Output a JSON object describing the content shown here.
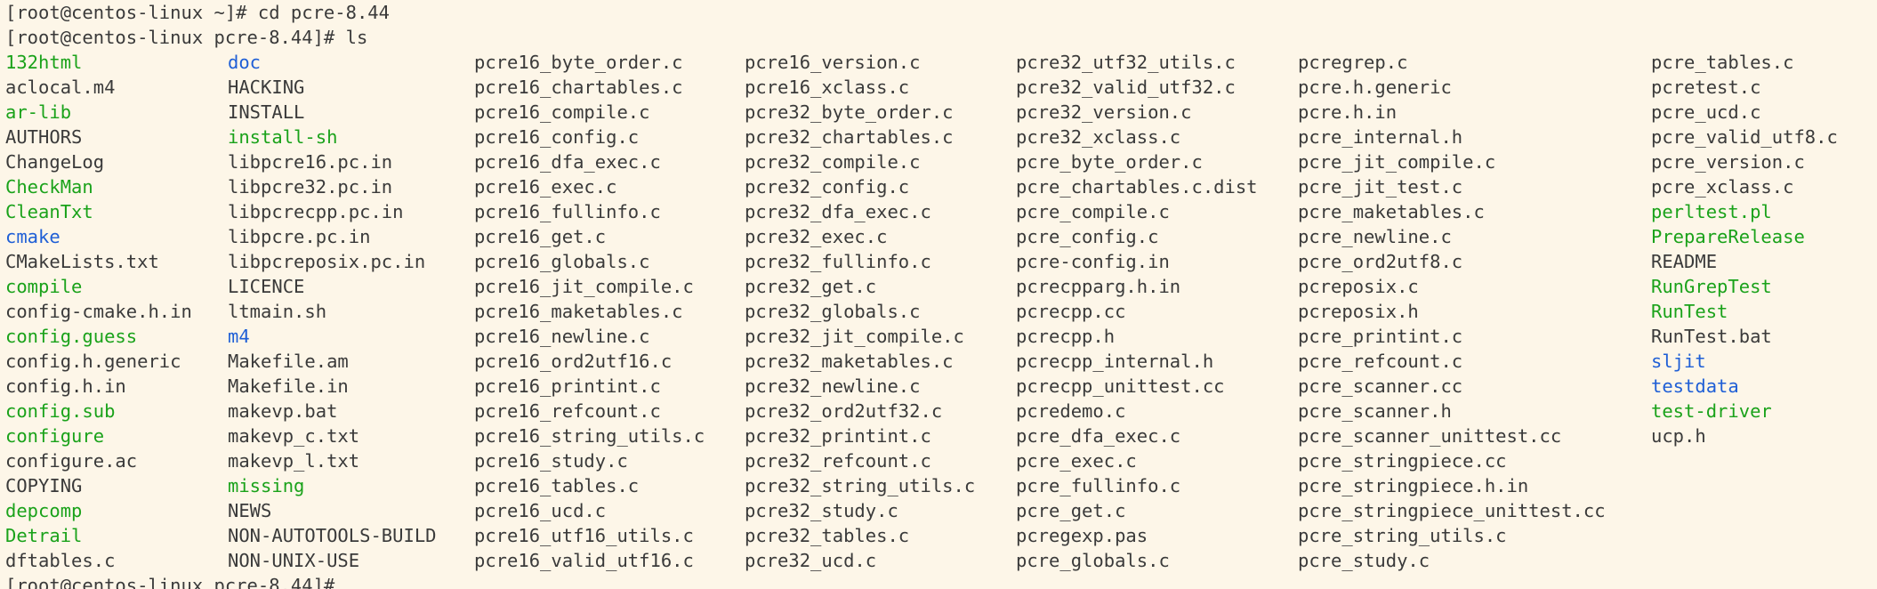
{
  "terminal": {
    "lines": [
      "[root@centos-linux ~]# cd pcre-8.44",
      "[root@centos-linux pcre-8.44]# ls"
    ],
    "final_prompt": "[root@centos-linux pcre-8.44]#",
    "colors": {
      "background": "#fdf6e8",
      "text": "#3a3a3a",
      "executable": "#1aa21a",
      "directory": "#1f5fd6"
    },
    "columns": [
      [
        {
          "name": "132html",
          "type": "exec"
        },
        {
          "name": "aclocal.m4",
          "type": "file"
        },
        {
          "name": "ar-lib",
          "type": "exec"
        },
        {
          "name": "AUTHORS",
          "type": "file"
        },
        {
          "name": "ChangeLog",
          "type": "file"
        },
        {
          "name": "CheckMan",
          "type": "exec"
        },
        {
          "name": "CleanTxt",
          "type": "exec"
        },
        {
          "name": "cmake",
          "type": "dir"
        },
        {
          "name": "CMakeLists.txt",
          "type": "file"
        },
        {
          "name": "compile",
          "type": "exec"
        },
        {
          "name": "config-cmake.h.in",
          "type": "file"
        },
        {
          "name": "config.guess",
          "type": "exec"
        },
        {
          "name": "config.h.generic",
          "type": "file"
        },
        {
          "name": "config.h.in",
          "type": "file"
        },
        {
          "name": "config.sub",
          "type": "exec"
        },
        {
          "name": "configure",
          "type": "exec"
        },
        {
          "name": "configure.ac",
          "type": "file"
        },
        {
          "name": "COPYING",
          "type": "file"
        },
        {
          "name": "depcomp",
          "type": "exec"
        },
        {
          "name": "Detrail",
          "type": "exec"
        },
        {
          "name": "dftables.c",
          "type": "file"
        }
      ],
      [
        {
          "name": "doc",
          "type": "dir"
        },
        {
          "name": "HACKING",
          "type": "file"
        },
        {
          "name": "INSTALL",
          "type": "file"
        },
        {
          "name": "install-sh",
          "type": "exec"
        },
        {
          "name": "libpcre16.pc.in",
          "type": "file"
        },
        {
          "name": "libpcre32.pc.in",
          "type": "file"
        },
        {
          "name": "libpcrecpp.pc.in",
          "type": "file"
        },
        {
          "name": "libpcre.pc.in",
          "type": "file"
        },
        {
          "name": "libpcreposix.pc.in",
          "type": "file"
        },
        {
          "name": "LICENCE",
          "type": "file"
        },
        {
          "name": "ltmain.sh",
          "type": "file"
        },
        {
          "name": "m4",
          "type": "dir"
        },
        {
          "name": "Makefile.am",
          "type": "file"
        },
        {
          "name": "Makefile.in",
          "type": "file"
        },
        {
          "name": "makevp.bat",
          "type": "file"
        },
        {
          "name": "makevp_c.txt",
          "type": "file"
        },
        {
          "name": "makevp_l.txt",
          "type": "file"
        },
        {
          "name": "missing",
          "type": "exec"
        },
        {
          "name": "NEWS",
          "type": "file"
        },
        {
          "name": "NON-AUTOTOOLS-BUILD",
          "type": "file"
        },
        {
          "name": "NON-UNIX-USE",
          "type": "file"
        }
      ],
      [
        {
          "name": "pcre16_byte_order.c",
          "type": "file"
        },
        {
          "name": "pcre16_chartables.c",
          "type": "file"
        },
        {
          "name": "pcre16_compile.c",
          "type": "file"
        },
        {
          "name": "pcre16_config.c",
          "type": "file"
        },
        {
          "name": "pcre16_dfa_exec.c",
          "type": "file"
        },
        {
          "name": "pcre16_exec.c",
          "type": "file"
        },
        {
          "name": "pcre16_fullinfo.c",
          "type": "file"
        },
        {
          "name": "pcre16_get.c",
          "type": "file"
        },
        {
          "name": "pcre16_globals.c",
          "type": "file"
        },
        {
          "name": "pcre16_jit_compile.c",
          "type": "file"
        },
        {
          "name": "pcre16_maketables.c",
          "type": "file"
        },
        {
          "name": "pcre16_newline.c",
          "type": "file"
        },
        {
          "name": "pcre16_ord2utf16.c",
          "type": "file"
        },
        {
          "name": "pcre16_printint.c",
          "type": "file"
        },
        {
          "name": "pcre16_refcount.c",
          "type": "file"
        },
        {
          "name": "pcre16_string_utils.c",
          "type": "file"
        },
        {
          "name": "pcre16_study.c",
          "type": "file"
        },
        {
          "name": "pcre16_tables.c",
          "type": "file"
        },
        {
          "name": "pcre16_ucd.c",
          "type": "file"
        },
        {
          "name": "pcre16_utf16_utils.c",
          "type": "file"
        },
        {
          "name": "pcre16_valid_utf16.c",
          "type": "file"
        }
      ],
      [
        {
          "name": "pcre16_version.c",
          "type": "file"
        },
        {
          "name": "pcre16_xclass.c",
          "type": "file"
        },
        {
          "name": "pcre32_byte_order.c",
          "type": "file"
        },
        {
          "name": "pcre32_chartables.c",
          "type": "file"
        },
        {
          "name": "pcre32_compile.c",
          "type": "file"
        },
        {
          "name": "pcre32_config.c",
          "type": "file"
        },
        {
          "name": "pcre32_dfa_exec.c",
          "type": "file"
        },
        {
          "name": "pcre32_exec.c",
          "type": "file"
        },
        {
          "name": "pcre32_fullinfo.c",
          "type": "file"
        },
        {
          "name": "pcre32_get.c",
          "type": "file"
        },
        {
          "name": "pcre32_globals.c",
          "type": "file"
        },
        {
          "name": "pcre32_jit_compile.c",
          "type": "file"
        },
        {
          "name": "pcre32_maketables.c",
          "type": "file"
        },
        {
          "name": "pcre32_newline.c",
          "type": "file"
        },
        {
          "name": "pcre32_ord2utf32.c",
          "type": "file"
        },
        {
          "name": "pcre32_printint.c",
          "type": "file"
        },
        {
          "name": "pcre32_refcount.c",
          "type": "file"
        },
        {
          "name": "pcre32_string_utils.c",
          "type": "file"
        },
        {
          "name": "pcre32_study.c",
          "type": "file"
        },
        {
          "name": "pcre32_tables.c",
          "type": "file"
        },
        {
          "name": "pcre32_ucd.c",
          "type": "file"
        }
      ],
      [
        {
          "name": "pcre32_utf32_utils.c",
          "type": "file"
        },
        {
          "name": "pcre32_valid_utf32.c",
          "type": "file"
        },
        {
          "name": "pcre32_version.c",
          "type": "file"
        },
        {
          "name": "pcre32_xclass.c",
          "type": "file"
        },
        {
          "name": "pcre_byte_order.c",
          "type": "file"
        },
        {
          "name": "pcre_chartables.c.dist",
          "type": "file"
        },
        {
          "name": "pcre_compile.c",
          "type": "file"
        },
        {
          "name": "pcre_config.c",
          "type": "file"
        },
        {
          "name": "pcre-config.in",
          "type": "file"
        },
        {
          "name": "pcrecpparg.h.in",
          "type": "file"
        },
        {
          "name": "pcrecpp.cc",
          "type": "file"
        },
        {
          "name": "pcrecpp.h",
          "type": "file"
        },
        {
          "name": "pcrecpp_internal.h",
          "type": "file"
        },
        {
          "name": "pcrecpp_unittest.cc",
          "type": "file"
        },
        {
          "name": "pcredemo.c",
          "type": "file"
        },
        {
          "name": "pcre_dfa_exec.c",
          "type": "file"
        },
        {
          "name": "pcre_exec.c",
          "type": "file"
        },
        {
          "name": "pcre_fullinfo.c",
          "type": "file"
        },
        {
          "name": "pcre_get.c",
          "type": "file"
        },
        {
          "name": "pcregexp.pas",
          "type": "file"
        },
        {
          "name": "pcre_globals.c",
          "type": "file"
        }
      ],
      [
        {
          "name": "pcregrep.c",
          "type": "file"
        },
        {
          "name": "pcre.h.generic",
          "type": "file"
        },
        {
          "name": "pcre.h.in",
          "type": "file"
        },
        {
          "name": "pcre_internal.h",
          "type": "file"
        },
        {
          "name": "pcre_jit_compile.c",
          "type": "file"
        },
        {
          "name": "pcre_jit_test.c",
          "type": "file"
        },
        {
          "name": "pcre_maketables.c",
          "type": "file"
        },
        {
          "name": "pcre_newline.c",
          "type": "file"
        },
        {
          "name": "pcre_ord2utf8.c",
          "type": "file"
        },
        {
          "name": "pcreposix.c",
          "type": "file"
        },
        {
          "name": "pcreposix.h",
          "type": "file"
        },
        {
          "name": "pcre_printint.c",
          "type": "file"
        },
        {
          "name": "pcre_refcount.c",
          "type": "file"
        },
        {
          "name": "pcre_scanner.cc",
          "type": "file"
        },
        {
          "name": "pcre_scanner.h",
          "type": "file"
        },
        {
          "name": "pcre_scanner_unittest.cc",
          "type": "file"
        },
        {
          "name": "pcre_stringpiece.cc",
          "type": "file"
        },
        {
          "name": "pcre_stringpiece.h.in",
          "type": "file"
        },
        {
          "name": "pcre_stringpiece_unittest.cc",
          "type": "file"
        },
        {
          "name": "pcre_string_utils.c",
          "type": "file"
        },
        {
          "name": "pcre_study.c",
          "type": "file"
        }
      ],
      [
        {
          "name": "pcre_tables.c",
          "type": "file"
        },
        {
          "name": "pcretest.c",
          "type": "file"
        },
        {
          "name": "pcre_ucd.c",
          "type": "file"
        },
        {
          "name": "pcre_valid_utf8.c",
          "type": "file"
        },
        {
          "name": "pcre_version.c",
          "type": "file"
        },
        {
          "name": "pcre_xclass.c",
          "type": "file"
        },
        {
          "name": "perltest.pl",
          "type": "exec"
        },
        {
          "name": "PrepareRelease",
          "type": "exec"
        },
        {
          "name": "README",
          "type": "file"
        },
        {
          "name": "RunGrepTest",
          "type": "exec"
        },
        {
          "name": "RunTest",
          "type": "exec"
        },
        {
          "name": "RunTest.bat",
          "type": "file"
        },
        {
          "name": "sljit",
          "type": "dir"
        },
        {
          "name": "testdata",
          "type": "dir"
        },
        {
          "name": "test-driver",
          "type": "exec"
        },
        {
          "name": "ucp.h",
          "type": "file"
        }
      ]
    ]
  }
}
